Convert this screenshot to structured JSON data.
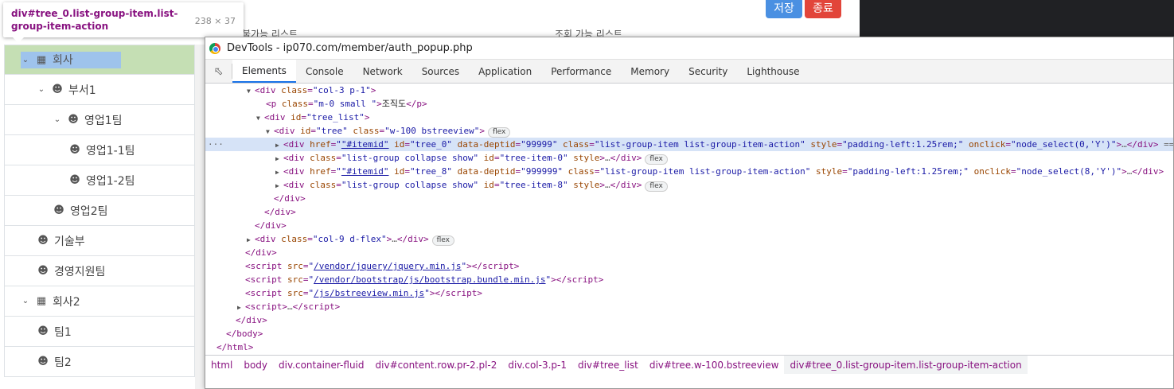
{
  "page": {
    "save_label": "저장",
    "close_label": "종료",
    "col_header_1": "불가능 리스트",
    "col_header_2": "조회 가능 리스트",
    "tree": [
      {
        "label": "회사",
        "icon": "building-icon",
        "chevron": true,
        "selected": true
      },
      {
        "label": "부서1",
        "icon": "users-icon",
        "chevron": true
      },
      {
        "label": "영업1팀",
        "icon": "user-group-icon",
        "chevron": true
      },
      {
        "label": "영업1-1팀",
        "icon": "user-group-icon"
      },
      {
        "label": "영업1-2팀",
        "icon": "user-group-icon"
      },
      {
        "label": "영업2팀",
        "icon": "user-group-icon"
      },
      {
        "label": "기술부",
        "icon": "users-icon"
      },
      {
        "label": "경영지원팀",
        "icon": "users-icon"
      },
      {
        "label": "회사2",
        "icon": "building-icon",
        "chevron": true
      },
      {
        "label": "팀1",
        "icon": "users-icon"
      },
      {
        "label": "팀2",
        "icon": "users-icon"
      }
    ]
  },
  "tooltip": {
    "selector": "div#tree_0.list-group-item.list-group-item-action",
    "dimensions": "238 × 37"
  },
  "devtools": {
    "title": "DevTools - ip070.com/member/auth_popup.php",
    "tabs": [
      "Elements",
      "Console",
      "Network",
      "Sources",
      "Application",
      "Performance",
      "Memory",
      "Security",
      "Lighthouse"
    ],
    "active_tab": "Elements",
    "breadcrumbs": [
      "html",
      "body",
      "div.container-fluid",
      "div#content.row.pr-2.pl-2",
      "div.col-3.p-1",
      "div#tree_list",
      "div#tree.w-100.bstreeview",
      "div#tree_0.list-group-item.list-group-item-action"
    ],
    "dom": {
      "l1": {
        "attr": "class",
        "val": "\"col-3 p-1\""
      },
      "l2": {
        "attr": "class",
        "val": "\"m-0 small \"",
        "text": "조직도"
      },
      "l3": {
        "attr": "id",
        "val": "\"tree_list\""
      },
      "l4": {
        "id": "\"tree\"",
        "cls": "\"w-100 bstreeview\"",
        "badge": "flex"
      },
      "l5": {
        "href": "\"#itemid\"",
        "id": "\"tree_0\"",
        "deptid": "\"99999\"",
        "cls": "\"list-group-item list-group-item-action\"",
        "style": "\"padding-left:1.25rem;\"",
        "onclick": "\"node_select(0,'Y')\"",
        "tail": "== $"
      },
      "l6": {
        "cls": "\"list-group collapse show\"",
        "id": "\"tree-item-0\"",
        "badge": "flex"
      },
      "l7": {
        "href": "\"#itemid\"",
        "id": "\"tree_8\"",
        "deptid": "\"999999\"",
        "cls": "\"list-group-item list-group-item-action\"",
        "style": "\"padding-left:1.25rem;\"",
        "onclick": "\"node_select(8,'Y')\""
      },
      "l8": {
        "cls": "\"list-group collapse show\"",
        "id": "\"tree-item-8\"",
        "badge": "flex"
      },
      "l12": {
        "cls": "\"col-9 d-flex\"",
        "badge": "flex"
      },
      "s1": "/vendor/jquery/jquery.min.js",
      "s2": "/vendor/bootstrap/js/bootstrap.bundle.min.js",
      "s3": "/js/bstreeview.min.js"
    }
  }
}
